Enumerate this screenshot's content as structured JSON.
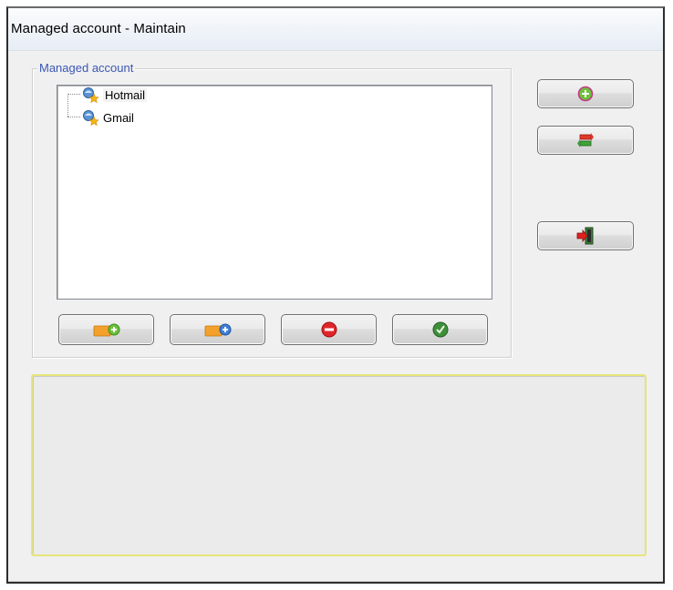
{
  "window": {
    "title": "Managed account - Maintain"
  },
  "group": {
    "legend": "Managed account",
    "accounts": [
      {
        "label": "Hotmail",
        "icon": "mail-account-icon"
      },
      {
        "label": "Gmail",
        "icon": "mail-account-icon"
      }
    ]
  },
  "side_buttons": [
    {
      "name": "add-button",
      "icon": "plus-circle-icon"
    },
    {
      "name": "refresh-button",
      "icon": "swap-arrows-icon"
    },
    {
      "name": "exit-button",
      "icon": "exit-door-icon"
    }
  ],
  "bottom_buttons": [
    {
      "name": "add-account-button",
      "icon": "folder-add-icon"
    },
    {
      "name": "edit-account-button",
      "icon": "folder-info-icon"
    },
    {
      "name": "delete-account-button",
      "icon": "minus-circle-icon"
    },
    {
      "name": "confirm-account-button",
      "icon": "check-circle-icon"
    }
  ],
  "colors": {
    "legend": "#3b57b5",
    "log_border": "#e6e47a"
  }
}
